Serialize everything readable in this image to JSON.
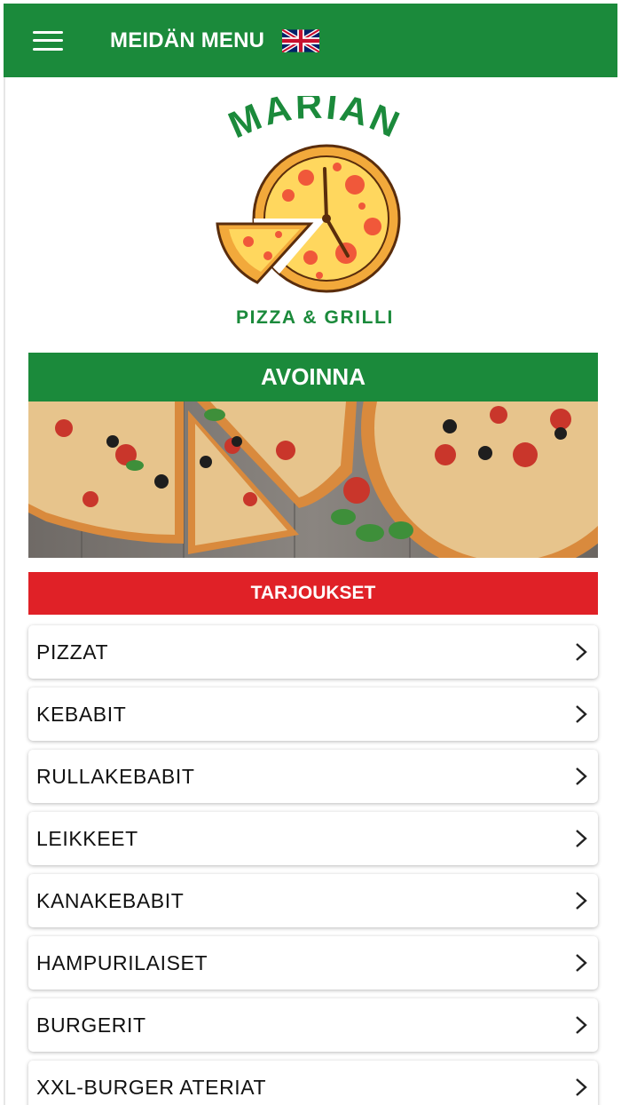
{
  "header": {
    "title": "MEIDÄN MENU",
    "menu_icon": "hamburger-icon",
    "language_icon": "uk-flag-icon"
  },
  "logo": {
    "wordmark": "MARIAN",
    "tagline": "PIZZA & GRILLI"
  },
  "status": {
    "label": "AVOINNA"
  },
  "offers": {
    "label": "TARJOUKSET"
  },
  "categories": [
    {
      "label": "PIZZAT"
    },
    {
      "label": "KEBABIT"
    },
    {
      "label": "RULLAKEBABIT"
    },
    {
      "label": "LEIKKEET"
    },
    {
      "label": "KANAKEBABIT"
    },
    {
      "label": "HAMPURILAISET"
    },
    {
      "label": "BURGERIT"
    },
    {
      "label": "XXL-BURGER ATERIAT"
    }
  ],
  "colors": {
    "brand_green": "#1b8a3b",
    "offers_red": "#e02127",
    "pizza_crust": "#f2a93b",
    "pizza_cheese": "#ffd75e"
  }
}
